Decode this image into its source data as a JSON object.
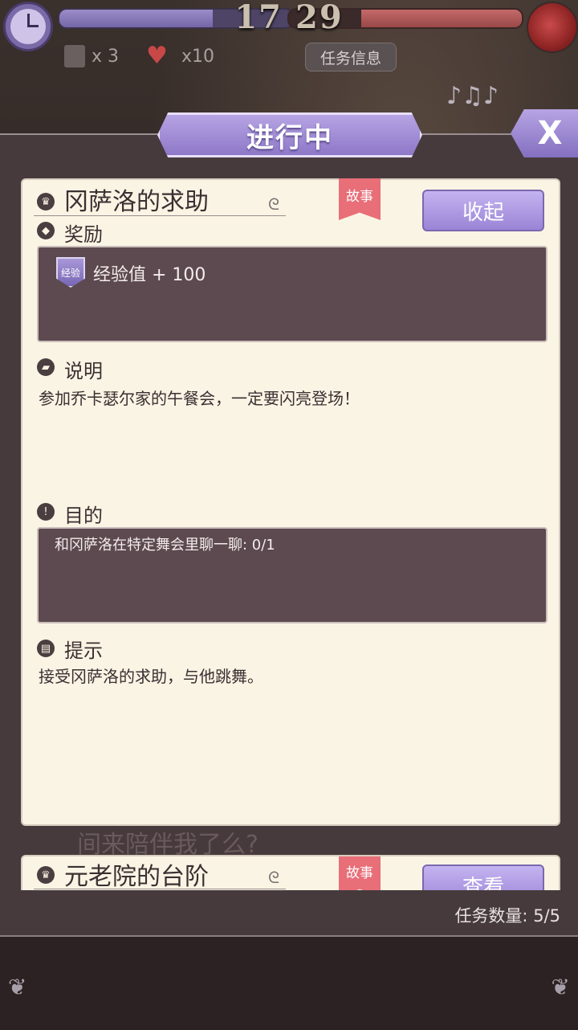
{
  "hud": {
    "score_left": "17",
    "score_right": "29",
    "left_bar_level": 0.66,
    "right_bar_level": 0.69,
    "scroll_count": "x 3",
    "heart_count": "x10",
    "task_info_label": "任务信息"
  },
  "modal": {
    "title": "进行中",
    "close_label": "X"
  },
  "quest": {
    "title": "冈萨洛的求助",
    "tag": "故事",
    "collapse_label": "收起",
    "reward_label": "奖励",
    "reward_badge": "经验",
    "reward_text": "经验值 + 100",
    "desc_label": "说明",
    "desc_text": "参加乔卡瑟尔家的午餐会，一定要闪亮登场！",
    "goal_label": "目的",
    "goal_text": "和冈萨洛在特定舞会里聊一聊: 0/1",
    "hint_label": "提示",
    "hint_text": "接受冈萨洛的求助，与他跳舞。"
  },
  "quest2": {
    "title": "元老院的台阶",
    "tag": "故事",
    "view_label": "查看"
  },
  "background_text": "间来陪伴我了么?",
  "footer": {
    "count_text": "任务数量:  5/5"
  },
  "colors": {
    "accent_purple": "#9a84d6",
    "tag_pink": "#e86e78",
    "card_bg": "#faf4e4",
    "dark_box": "#5c4a50"
  }
}
